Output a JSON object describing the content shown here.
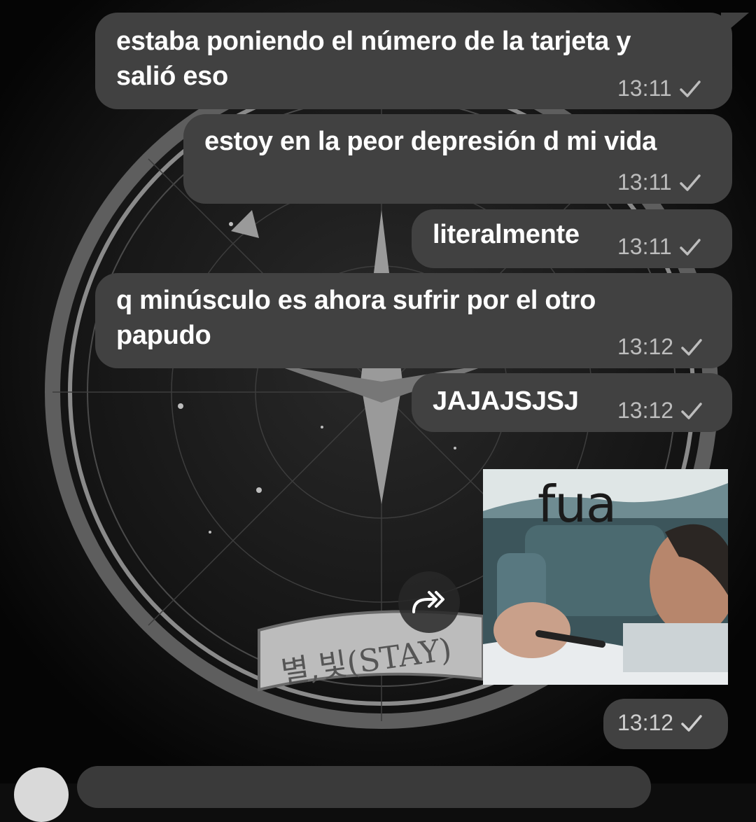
{
  "messages": [
    {
      "text_line1": "estaba poniendo el número de la tarjeta y",
      "text_line2": "salió eso",
      "time": "13:11"
    },
    {
      "text_line1": "estoy en la peor depresión d mi vida",
      "time": "13:11"
    },
    {
      "text_line1": "literalmente",
      "time": "13:11"
    },
    {
      "text_line1": "q minúsculo es ahora sufrir por el otro",
      "text_line2": "papudo",
      "time": "13:12"
    },
    {
      "text_line1": "JAJAJSJSJ",
      "time": "13:12"
    }
  ],
  "sticker": {
    "caption": "fua",
    "time": "13:12"
  },
  "wallpaper": {
    "badge_text": "별,빛(STAY)"
  },
  "colors": {
    "bubble": "#414141",
    "meta_text": "#bdbdbd",
    "background": "#0d0d0d"
  },
  "icons": {
    "forward": "forward-icon",
    "read_check": "check-icon"
  }
}
